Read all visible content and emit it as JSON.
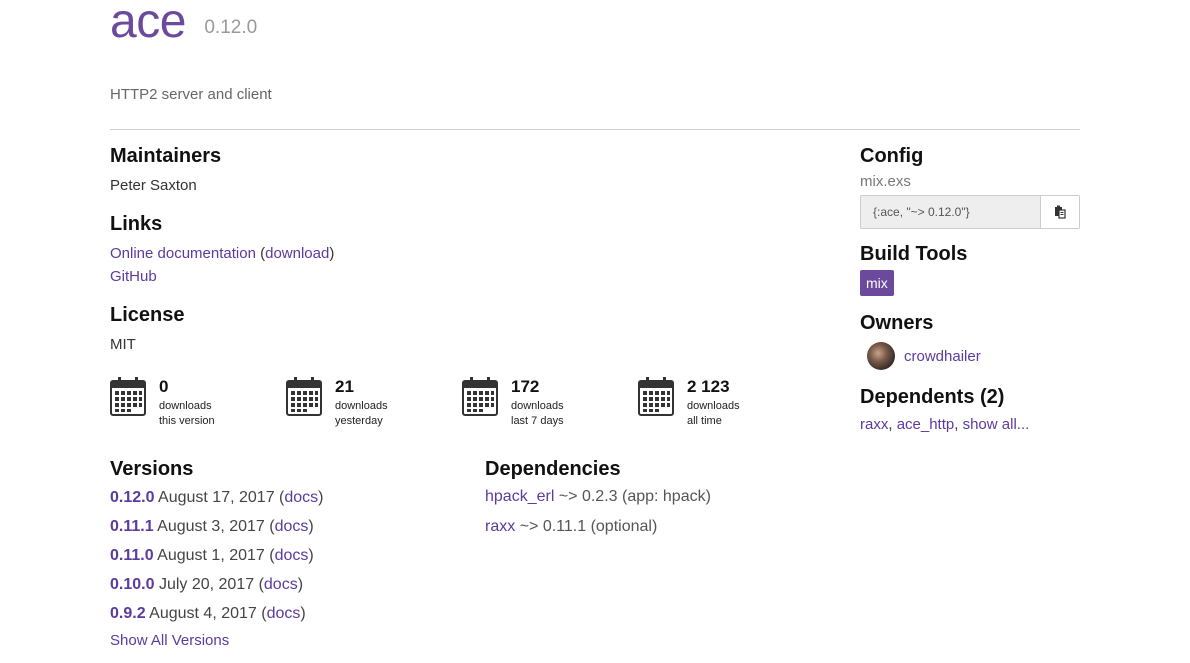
{
  "package": {
    "name": "ace",
    "version": "0.12.0",
    "description": "HTTP2 server and client"
  },
  "maintainers": {
    "title": "Maintainers",
    "names": [
      "Peter Saxton"
    ]
  },
  "links": {
    "title": "Links",
    "online_docs": "Online documentation",
    "open_paren": "(",
    "download": "download",
    "close_paren": ")",
    "github": "GitHub"
  },
  "license": {
    "title": "License",
    "value": "MIT"
  },
  "stats": [
    {
      "count": "0",
      "line1": "downloads",
      "line2": "this version",
      "icon": "calendar-icon"
    },
    {
      "count": "21",
      "line1": "downloads",
      "line2": "yesterday",
      "icon": "calendar-icon"
    },
    {
      "count": "172",
      "line1": "downloads",
      "line2": "last 7 days",
      "icon": "calendar-icon"
    },
    {
      "count": "2 123",
      "line1": "downloads",
      "line2": "all time",
      "icon": "calendar-icon"
    }
  ],
  "versions": {
    "title": "Versions",
    "items": [
      {
        "version": "0.12.0",
        "date": "August 17, 2017",
        "docs": "docs"
      },
      {
        "version": "0.11.1",
        "date": "August 3, 2017",
        "docs": "docs"
      },
      {
        "version": "0.11.0",
        "date": "August 1, 2017",
        "docs": "docs"
      },
      {
        "version": "0.10.0",
        "date": "July 20, 2017",
        "docs": "docs"
      },
      {
        "version": "0.9.2",
        "date": "August 4, 2017",
        "docs": "docs"
      }
    ],
    "show_all": "Show All Versions"
  },
  "dependencies": {
    "title": "Dependencies",
    "items": [
      {
        "name": "hpack_erl",
        "requirement": "~> 0.2.3 (app: hpack)"
      },
      {
        "name": "raxx",
        "requirement": "~> 0.11.1 (optional)"
      }
    ]
  },
  "config": {
    "title": "Config",
    "file": "mix.exs",
    "snippet": "{:ace, \"~> 0.12.0\"}",
    "copy_icon": "clipboard-icon"
  },
  "build_tools": {
    "title": "Build Tools",
    "tools": [
      "mix"
    ]
  },
  "owners": {
    "title": "Owners",
    "items": [
      {
        "name": "crowdhailer"
      }
    ]
  },
  "dependents": {
    "title": "Dependents (2)",
    "items": [
      "raxx",
      "ace_http"
    ],
    "show_all": "show all..."
  },
  "colors": {
    "brand": "#6b4a9e",
    "link": "#5c3a9e"
  }
}
